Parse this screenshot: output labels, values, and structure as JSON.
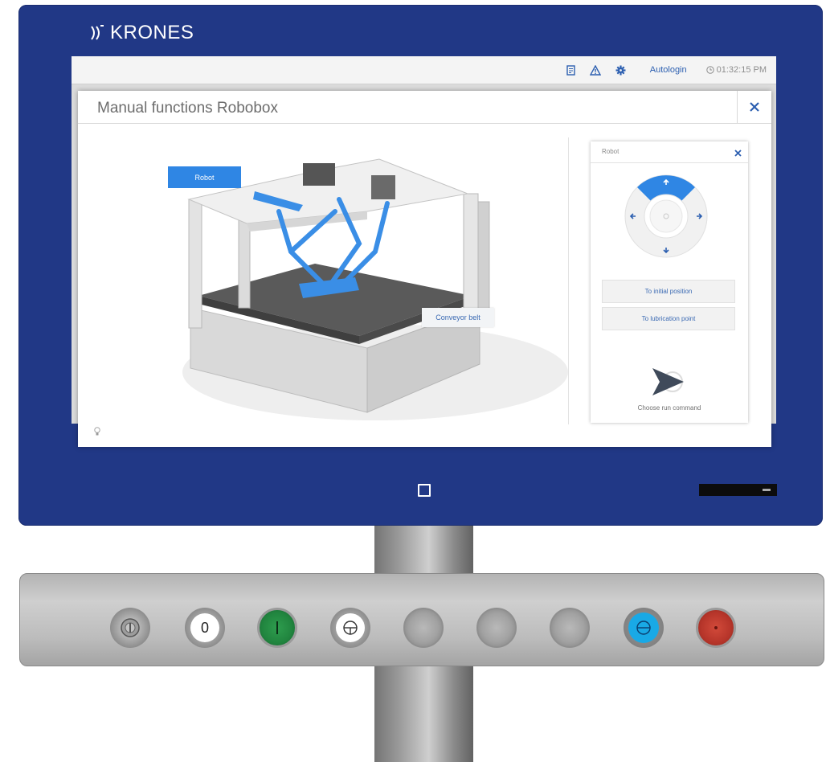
{
  "brand": {
    "name": "KRONES"
  },
  "topbar": {
    "icons": [
      "checklist-icon",
      "warning-icon",
      "gear-icon"
    ],
    "autologin_label": "Autologin",
    "time": "01:32:15 PM"
  },
  "dialog": {
    "title": "Manual functions Robobox",
    "close_icon": "close-icon"
  },
  "scene": {
    "robot_label": "Robot",
    "conveyor_label": "Conveyor belt"
  },
  "robot_panel": {
    "title": "Robot",
    "joystick_directions": [
      "up",
      "left",
      "right",
      "down"
    ],
    "buttons": {
      "initial_position": "To initial position",
      "lubrication_point": "To lubrication point"
    },
    "run_command_label": "Choose run command"
  },
  "hardware_panel": {
    "zero_label": "0",
    "buttons": [
      "key-switch",
      "off",
      "on",
      "reset",
      "blank",
      "blank",
      "blank",
      "blue-function",
      "emergency-stop"
    ]
  },
  "colors": {
    "housing": "#213886",
    "accent": "#2f86e4",
    "link": "#2c5fb0"
  }
}
